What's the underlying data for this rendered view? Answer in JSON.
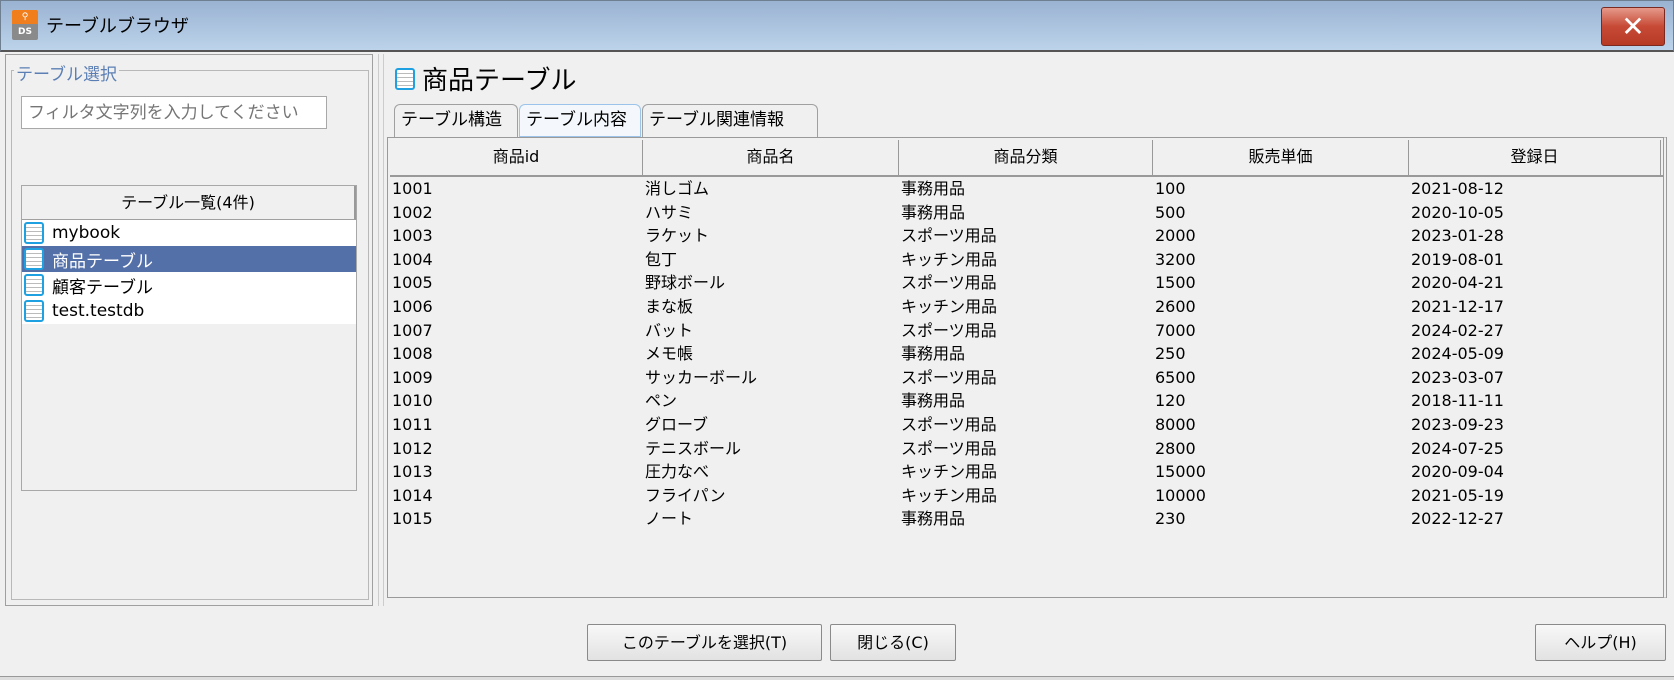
{
  "window": {
    "title": "テーブルブラウザ",
    "app_icon_text": "DS",
    "close_label": "✕"
  },
  "left": {
    "group_label": "テーブル選択",
    "filter_placeholder": "フィルタ文字列を入力してください",
    "list_header": "テーブル一覧(4件)",
    "items": [
      {
        "label": "mybook",
        "selected": false
      },
      {
        "label": "商品テーブル",
        "selected": true
      },
      {
        "label": "顧客テーブル",
        "selected": false
      },
      {
        "label": "test.testdb",
        "selected": false
      }
    ]
  },
  "right": {
    "title": "商品テーブル",
    "tabs": [
      {
        "label": "テーブル構造"
      },
      {
        "label": "テーブル内容",
        "active": true
      },
      {
        "label": "テーブル関連情報"
      }
    ],
    "columns": [
      "商品id",
      "商品名",
      "商品分類",
      "販売単価",
      "登録日"
    ],
    "rows": [
      [
        "1001",
        "消しゴム",
        "事務用品",
        "100",
        "2021-08-12"
      ],
      [
        "1002",
        "ハサミ",
        "事務用品",
        "500",
        "2020-10-05"
      ],
      [
        "1003",
        "ラケット",
        "スポーツ用品",
        "2000",
        "2023-01-28"
      ],
      [
        "1004",
        "包丁",
        "キッチン用品",
        "3200",
        "2019-08-01"
      ],
      [
        "1005",
        "野球ボール",
        "スポーツ用品",
        "1500",
        "2020-04-21"
      ],
      [
        "1006",
        "まな板",
        "キッチン用品",
        "2600",
        "2021-12-17"
      ],
      [
        "1007",
        "バット",
        "スポーツ用品",
        "7000",
        "2024-02-27"
      ],
      [
        "1008",
        "メモ帳",
        "事務用品",
        "250",
        "2024-05-09"
      ],
      [
        "1009",
        "サッカーボール",
        "スポーツ用品",
        "6500",
        "2023-03-07"
      ],
      [
        "1010",
        "ペン",
        "事務用品",
        "120",
        "2018-11-11"
      ],
      [
        "1011",
        "グローブ",
        "スポーツ用品",
        "8000",
        "2023-09-23"
      ],
      [
        "1012",
        "テニスボール",
        "スポーツ用品",
        "2800",
        "2024-07-25"
      ],
      [
        "1013",
        "圧力なべ",
        "キッチン用品",
        "15000",
        "2020-09-04"
      ],
      [
        "1014",
        "フライパン",
        "キッチン用品",
        "10000",
        "2021-05-19"
      ],
      [
        "1015",
        "ノート",
        "事務用品",
        "230",
        "2022-12-27"
      ]
    ]
  },
  "buttons": {
    "select": "このテーブルを選択(T)",
    "close": "閉じる(C)",
    "help": "ヘルプ(H)"
  },
  "colors": {
    "selection": "#5470a8",
    "group_label": "#5b7fb5",
    "close_button": "#c64a36"
  }
}
